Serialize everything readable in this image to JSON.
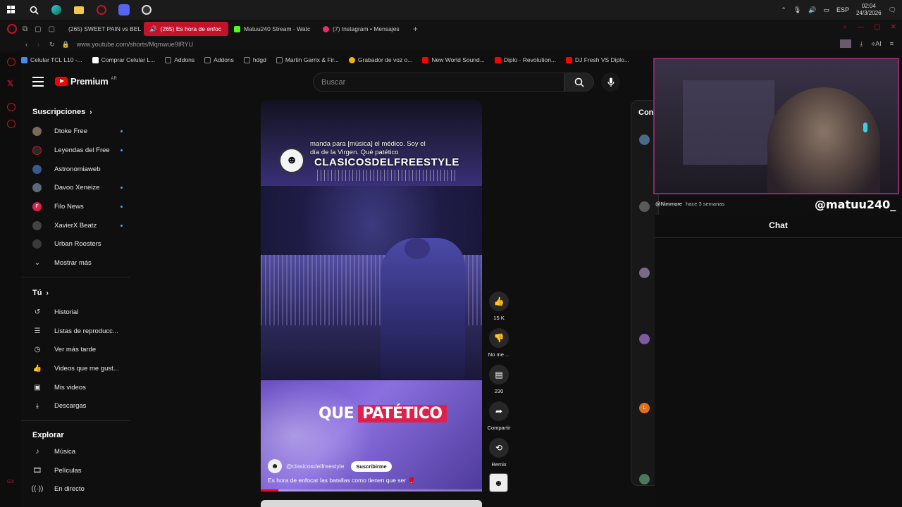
{
  "taskbar": {
    "lang": "ESP",
    "time": "02:04",
    "date": "24/3/2026"
  },
  "tabs": [
    {
      "label": "(265) SWEET PAIN vs BEL",
      "color": "#ff0000"
    },
    {
      "label": "(265) Es hora de enfoc",
      "color": "#ffffff"
    },
    {
      "label": "Matuu240 Stream - Watc",
      "color": "#53fc18"
    },
    {
      "label": "(7) Instagram • Mensajes",
      "color": "#e1306c"
    }
  ],
  "address": {
    "url": "www.youtube.com/shorts/Mqmwue9IRYU"
  },
  "bookmarks": [
    {
      "label": "Celular TCL L10 -...",
      "color": "#4a8af4"
    },
    {
      "label": "Comprar Celular L...",
      "color": "#ffffff"
    },
    {
      "label": "Addons",
      "color": "#888888"
    },
    {
      "label": "Addons",
      "color": "#888888"
    },
    {
      "label": "hdgd",
      "color": "#888888"
    },
    {
      "label": "Martin Garrix & Fir...",
      "color": "#888888"
    },
    {
      "label": "Grabador de voz o...",
      "color": "#f4b400"
    },
    {
      "label": "New World Sound...",
      "color": "#ff0000"
    },
    {
      "label": "Diplo - Revolution...",
      "color": "#ff0000"
    },
    {
      "label": "DJ Fresh VS Diplo...",
      "color": "#ff0000"
    }
  ],
  "youtube": {
    "brand": "Premium",
    "region": "AR",
    "search_placeholder": "Buscar"
  },
  "sidebar": {
    "subs_heading": "Suscripciones",
    "subs": [
      {
        "label": "Dtoke Free",
        "color": "#7a6a5a",
        "new": true
      },
      {
        "label": "Leyendas del Free",
        "color": "#2a2a2a",
        "new": true
      },
      {
        "label": "Astronomiaweb",
        "color": "#3a5a8a",
        "new": false
      },
      {
        "label": "Davoo Xeneize",
        "color": "#5a6a7a",
        "new": true
      },
      {
        "label": "Filo News",
        "color": "#e0204c",
        "new": true
      },
      {
        "label": "XavierX Beatz",
        "color": "#444444",
        "new": true
      },
      {
        "label": "Urban Roosters",
        "color": "#3a3a3a",
        "new": false
      }
    ],
    "show_more": "Mostrar más",
    "you_heading": "Tú",
    "you_items": [
      {
        "label": "Historial",
        "icon": "history-icon"
      },
      {
        "label": "Listas de reproducc...",
        "icon": "playlist-icon"
      },
      {
        "label": "Ver más tarde",
        "icon": "watch-later-icon"
      },
      {
        "label": "Videos que me gust...",
        "icon": "like-icon"
      },
      {
        "label": "Mis videos",
        "icon": "my-videos-icon"
      },
      {
        "label": "Descargas",
        "icon": "download-icon"
      }
    ],
    "explore_heading": "Explorar",
    "explore_items": [
      {
        "label": "Música",
        "icon": "music-icon"
      },
      {
        "label": "Películas",
        "icon": "movies-icon"
      },
      {
        "label": "En directo",
        "icon": "live-icon"
      }
    ]
  },
  "short": {
    "caption": "manda para [música] el médico. Soy el día de la Virgen. Qué patético",
    "brand_overlay": "CLASICOSDELFREESTYLE",
    "big_text_1": "QUE",
    "big_text_2": "PATÉTICO",
    "channel": "@clasicosdelfreestyle",
    "subscribe": "Suscribirme",
    "description": "Es hora de enfocar las batallas como tienen que ser 🥊",
    "progress": 0.08
  },
  "actions": {
    "likes": "15 K",
    "dislike": "No me ...",
    "comments": "230",
    "share": "Compartir",
    "remix": "Remix"
  },
  "comments_panel": {
    "title": "Con"
  },
  "stream": {
    "handle": "@matuu240_",
    "comment_user": "@Nimmore",
    "comment_time": "hace 3 semanas",
    "chat_title": "Chat"
  }
}
